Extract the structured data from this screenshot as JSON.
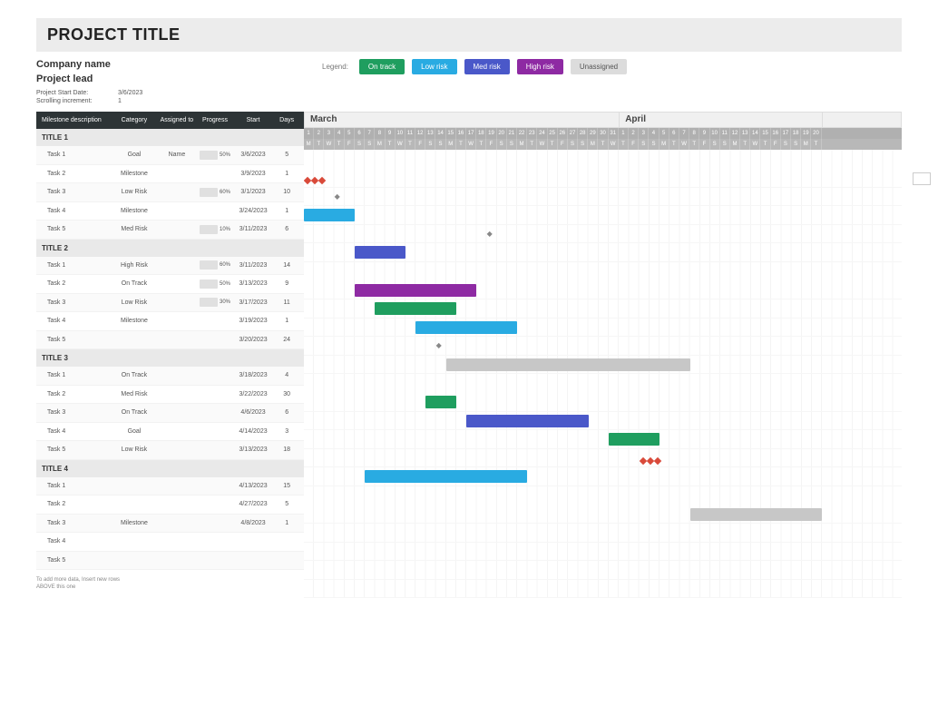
{
  "title": "PROJECT TITLE",
  "company": "Company name",
  "lead": "Project lead",
  "meta": {
    "start_label": "Project Start Date:",
    "start_value": "3/6/2023",
    "scroll_label": "Scrolling increment:",
    "scroll_value": "1"
  },
  "legend": {
    "label": "Legend:",
    "items": [
      {
        "key": "ontrack",
        "text": "On track"
      },
      {
        "key": "lowrisk",
        "text": "Low risk"
      },
      {
        "key": "medrisk",
        "text": "Med risk"
      },
      {
        "key": "highrisk",
        "text": "High risk"
      },
      {
        "key": "unassigned",
        "text": "Unassigned"
      }
    ]
  },
  "columns": {
    "desc": "Milestone description",
    "cat": "Category",
    "asg": "Assigned to",
    "prog": "Progress",
    "start": "Start",
    "days": "Days"
  },
  "timeline": {
    "months": [
      {
        "name": "March",
        "days": 31
      },
      {
        "name": "April",
        "days": 20
      }
    ],
    "start_day_index": 0,
    "weekdays_cycle": [
      "M",
      "T",
      "W",
      "T",
      "F",
      "S",
      "S"
    ]
  },
  "sections": [
    {
      "title": "TITLE 1",
      "rows": [
        {
          "desc": "Task 1",
          "cat": "Goal",
          "asg": "Name",
          "prog": 50,
          "start": "3/6/2023",
          "days": 5,
          "type": "goal",
          "offset": 0
        },
        {
          "desc": "Task 2",
          "cat": "Milestone",
          "asg": "",
          "prog": null,
          "start": "3/9/2023",
          "days": 1,
          "type": "milestone",
          "offset": 3
        },
        {
          "desc": "Task 3",
          "cat": "Low Risk",
          "asg": "",
          "prog": 60,
          "start": "3/1/2023",
          "days": 10,
          "type": "lowrisk",
          "offset": 0,
          "bar_days": 5
        },
        {
          "desc": "Task 4",
          "cat": "Milestone",
          "asg": "",
          "prog": null,
          "start": "3/24/2023",
          "days": 1,
          "type": "milestone",
          "offset": 18
        },
        {
          "desc": "Task 5",
          "cat": "Med Risk",
          "asg": "",
          "prog": 10,
          "start": "3/11/2023",
          "days": 6,
          "type": "medrisk",
          "offset": 5,
          "bar_days": 5
        }
      ]
    },
    {
      "title": "TITLE 2",
      "rows": [
        {
          "desc": "Task 1",
          "cat": "High Risk",
          "asg": "",
          "prog": 60,
          "start": "3/11/2023",
          "days": 14,
          "type": "highrisk",
          "offset": 5,
          "bar_days": 12
        },
        {
          "desc": "Task 2",
          "cat": "On Track",
          "asg": "",
          "prog": 50,
          "start": "3/13/2023",
          "days": 9,
          "type": "ontrack",
          "offset": 7,
          "bar_days": 8
        },
        {
          "desc": "Task 3",
          "cat": "Low Risk",
          "asg": "",
          "prog": 30,
          "start": "3/17/2023",
          "days": 11,
          "type": "lowrisk",
          "offset": 11,
          "bar_days": 10
        },
        {
          "desc": "Task 4",
          "cat": "Milestone",
          "asg": "",
          "prog": null,
          "start": "3/19/2023",
          "days": 1,
          "type": "milestone",
          "offset": 13
        },
        {
          "desc": "Task 5",
          "cat": "",
          "asg": "",
          "prog": null,
          "start": "3/20/2023",
          "days": 24,
          "type": "unassigned",
          "offset": 14,
          "bar_days": 24
        }
      ]
    },
    {
      "title": "TITLE 3",
      "rows": [
        {
          "desc": "Task 1",
          "cat": "On Track",
          "asg": "",
          "prog": null,
          "start": "3/18/2023",
          "days": 4,
          "type": "ontrack",
          "offset": 12,
          "bar_days": 3
        },
        {
          "desc": "Task 2",
          "cat": "Med Risk",
          "asg": "",
          "prog": null,
          "start": "3/22/2023",
          "days": 30,
          "type": "medrisk",
          "offset": 16,
          "bar_days": 12
        },
        {
          "desc": "Task 3",
          "cat": "On Track",
          "asg": "",
          "prog": null,
          "start": "4/6/2023",
          "days": 6,
          "type": "ontrack",
          "offset": 30,
          "bar_days": 5
        },
        {
          "desc": "Task 4",
          "cat": "Goal",
          "asg": "",
          "prog": null,
          "start": "4/14/2023",
          "days": 3,
          "type": "goal",
          "offset": 33
        },
        {
          "desc": "Task 5",
          "cat": "Low Risk",
          "asg": "",
          "prog": null,
          "start": "3/13/2023",
          "days": 18,
          "type": "lowrisk",
          "offset": 6,
          "bar_days": 16
        }
      ]
    },
    {
      "title": "TITLE 4",
      "rows": [
        {
          "desc": "Task 1",
          "cat": "",
          "asg": "",
          "prog": null,
          "start": "4/13/2023",
          "days": 15,
          "type": "unassigned",
          "offset": 38,
          "bar_days": 13
        },
        {
          "desc": "Task 2",
          "cat": "",
          "asg": "",
          "prog": null,
          "start": "4/27/2023",
          "days": 5,
          "type": "none"
        },
        {
          "desc": "Task 3",
          "cat": "Milestone",
          "asg": "",
          "prog": null,
          "start": "4/8/2023",
          "days": 1,
          "type": "none"
        },
        {
          "desc": "Task 4",
          "cat": "",
          "asg": "",
          "prog": null,
          "start": "",
          "days": "",
          "type": "none"
        },
        {
          "desc": "Task 5",
          "cat": "",
          "asg": "",
          "prog": null,
          "start": "",
          "days": "",
          "type": "none"
        }
      ]
    }
  ],
  "footnote": "To add more data, Insert new rows ABOVE this one",
  "chart_data": {
    "type": "gantt",
    "title": "PROJECT TITLE",
    "x_start": "2023-03-01",
    "x_end": "2023-04-20",
    "categories_legend": [
      "On track",
      "Low risk",
      "Med risk",
      "High risk",
      "Unassigned",
      "Goal",
      "Milestone"
    ],
    "colors": {
      "On track": "#1f9e5f",
      "Low risk": "#29abe2",
      "Med risk": "#4a58c9",
      "High risk": "#8e2aa3",
      "Unassigned": "#c7c7c7"
    },
    "series": [
      {
        "group": "TITLE 1",
        "task": "Task 1",
        "category": "Goal",
        "start": "2023-03-06",
        "days": 5,
        "progress": 50
      },
      {
        "group": "TITLE 1",
        "task": "Task 2",
        "category": "Milestone",
        "start": "2023-03-09",
        "days": 1
      },
      {
        "group": "TITLE 1",
        "task": "Task 3",
        "category": "Low risk",
        "start": "2023-03-01",
        "days": 10,
        "progress": 60
      },
      {
        "group": "TITLE 1",
        "task": "Task 4",
        "category": "Milestone",
        "start": "2023-03-24",
        "days": 1
      },
      {
        "group": "TITLE 1",
        "task": "Task 5",
        "category": "Med risk",
        "start": "2023-03-11",
        "days": 6,
        "progress": 10
      },
      {
        "group": "TITLE 2",
        "task": "Task 1",
        "category": "High risk",
        "start": "2023-03-11",
        "days": 14,
        "progress": 60
      },
      {
        "group": "TITLE 2",
        "task": "Task 2",
        "category": "On track",
        "start": "2023-03-13",
        "days": 9,
        "progress": 50
      },
      {
        "group": "TITLE 2",
        "task": "Task 3",
        "category": "Low risk",
        "start": "2023-03-17",
        "days": 11,
        "progress": 30
      },
      {
        "group": "TITLE 2",
        "task": "Task 4",
        "category": "Milestone",
        "start": "2023-03-19",
        "days": 1
      },
      {
        "group": "TITLE 2",
        "task": "Task 5",
        "category": "Unassigned",
        "start": "2023-03-20",
        "days": 24
      },
      {
        "group": "TITLE 3",
        "task": "Task 1",
        "category": "On track",
        "start": "2023-03-18",
        "days": 4
      },
      {
        "group": "TITLE 3",
        "task": "Task 2",
        "category": "Med risk",
        "start": "2023-03-22",
        "days": 30
      },
      {
        "group": "TITLE 3",
        "task": "Task 3",
        "category": "On track",
        "start": "2023-04-06",
        "days": 6
      },
      {
        "group": "TITLE 3",
        "task": "Task 4",
        "category": "Goal",
        "start": "2023-04-14",
        "days": 3
      },
      {
        "group": "TITLE 3",
        "task": "Task 5",
        "category": "Low risk",
        "start": "2023-03-13",
        "days": 18
      },
      {
        "group": "TITLE 4",
        "task": "Task 1",
        "category": "Unassigned",
        "start": "2023-04-13",
        "days": 15
      },
      {
        "group": "TITLE 4",
        "task": "Task 2",
        "category": "Unassigned",
        "start": "2023-04-27",
        "days": 5
      },
      {
        "group": "TITLE 4",
        "task": "Task 3",
        "category": "Milestone",
        "start": "2023-04-08",
        "days": 1
      }
    ]
  }
}
